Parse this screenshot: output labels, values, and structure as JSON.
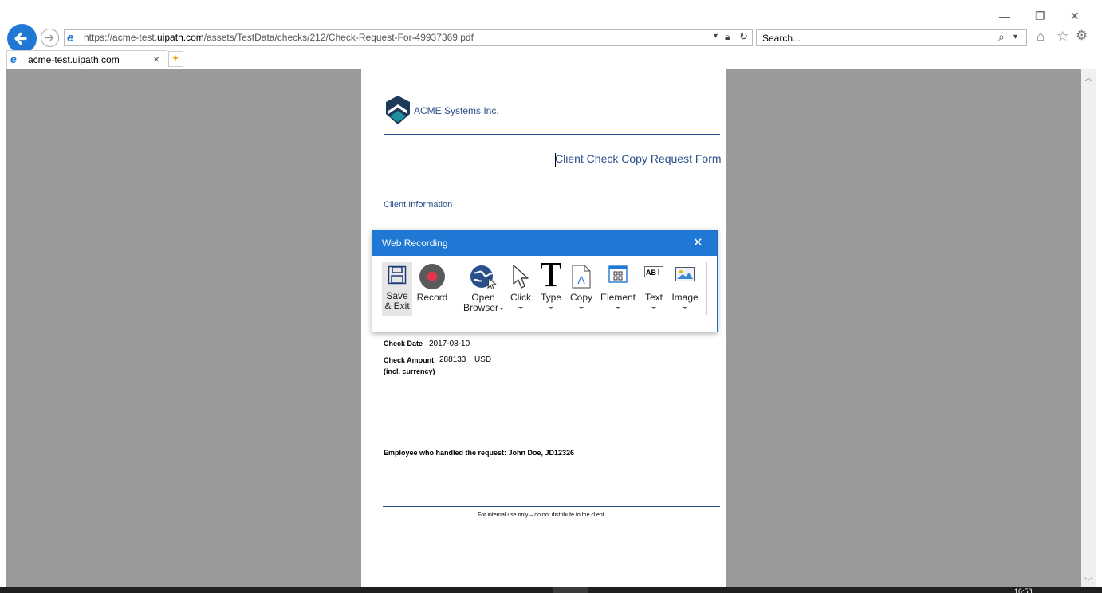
{
  "browser": {
    "url_prefix": "https://acme-test.",
    "url_domain": "uipath.com",
    "url_path": "/assets/TestData/checks/212/Check-Request-For-49937369.pdf",
    "search_placeholder": "Search...",
    "tab_title": "acme-test.uipath.com",
    "tab_close": "×"
  },
  "pdf": {
    "company": "ACME Systems Inc.",
    "form_title": "Client Check Copy Request Form",
    "section_client": "Client Information",
    "check_date_label": "Check Date",
    "check_date_value": "2017-08-10",
    "check_amount_label": "Check Amount",
    "check_amount_value": "288133",
    "check_currency": "USD",
    "incl_currency": "(incl. currency)",
    "employee_line": "Employee who handled the request: John Doe, JD12326",
    "footer": "For internal use only – do not distribute to the client"
  },
  "recorder": {
    "title": "Web Recording",
    "tools": {
      "save_line1": "Save",
      "save_line2": "& Exit",
      "record": "Record",
      "open_line1": "Open",
      "open_line2": "Browser",
      "click": "Click",
      "type": "Type",
      "copy": "Copy",
      "element": "Element",
      "text": "Text",
      "image": "Image"
    }
  },
  "taskbar": {
    "clock": "16:58"
  },
  "colors": {
    "accent": "#1e78d4",
    "pdf_blue": "#2a4f8a",
    "viewer_bg": "#9a9a9a",
    "record_red": "#e8334a"
  }
}
